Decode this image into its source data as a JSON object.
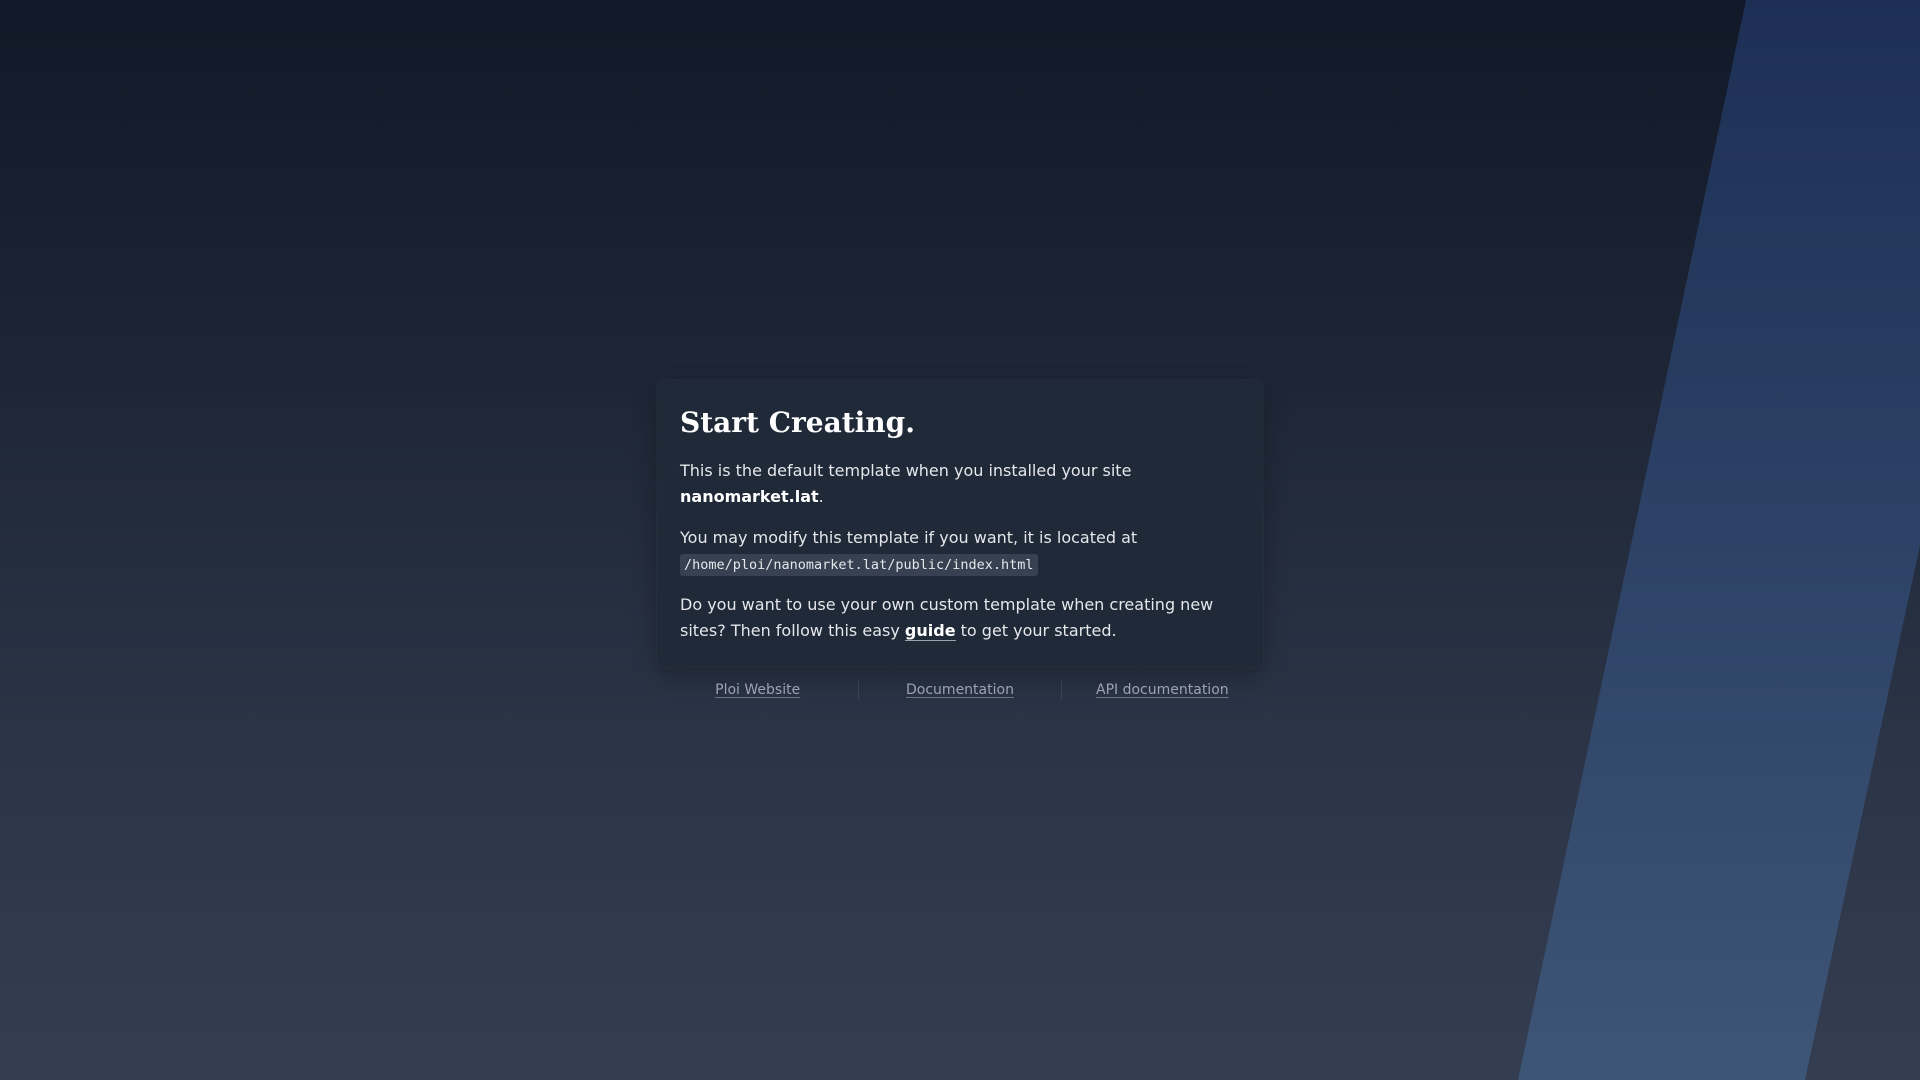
{
  "card": {
    "title": "Start Creating.",
    "intro_text": "This is the default template when you installed your site",
    "site_name": "nanomarket.lat",
    "site_suffix": ".",
    "modify_text": "You may modify this template if you want, it is located at",
    "path": "/home/ploi/nanomarket.lat/public/index.html",
    "custom_text": "Do you want to use your own custom template when creating new sites? Then follow this easy",
    "guide_label": "guide",
    "custom_suffix": "to get your started."
  },
  "footer": {
    "links": [
      {
        "label": "Ploi Website"
      },
      {
        "label": "Documentation"
      },
      {
        "label": "API documentation"
      }
    ]
  },
  "colors": {
    "background_top": "#111827",
    "background_bottom": "#343e50",
    "card": "#1f2937",
    "stripe": "#2f4a74"
  }
}
